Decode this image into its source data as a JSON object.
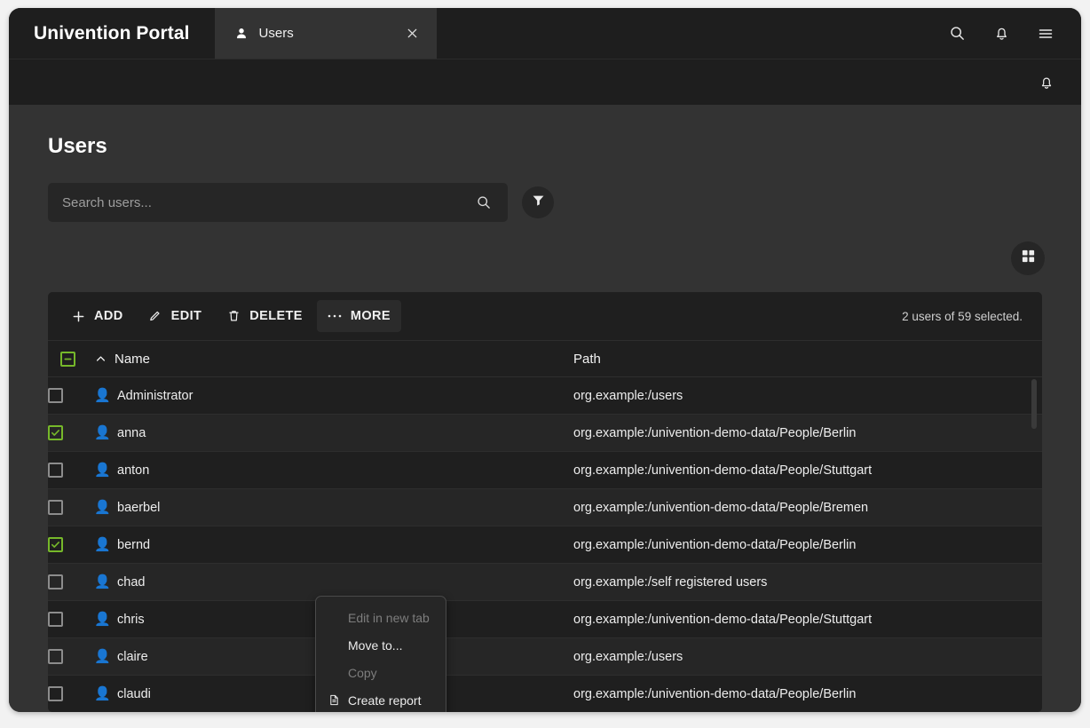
{
  "header": {
    "brand": "Univention Portal",
    "tab": {
      "label": "Users",
      "icon": "user-icon",
      "close_icon": "close-icon"
    },
    "actions": [
      {
        "name": "search-icon",
        "label": "Search"
      },
      {
        "name": "notifications-icon",
        "label": "Notifications"
      },
      {
        "name": "hamburger-menu-icon",
        "label": "Menu"
      }
    ]
  },
  "subbar": {
    "notification_icon": "bell-icon"
  },
  "main": {
    "title": "Users",
    "search": {
      "value": "",
      "placeholder": "Search users...",
      "submit_icon": "search-icon"
    },
    "filter_button": {
      "icon": "filter-icon"
    },
    "view_toggle": {
      "icon": "grid-view-icon"
    }
  },
  "toolbar": {
    "add_label": "ADD",
    "edit_label": "EDIT",
    "delete_label": "DELETE",
    "more_label": "MORE",
    "selection_info": "2 users of 59 selected."
  },
  "more_menu": {
    "items": [
      {
        "label": "Edit in new tab",
        "disabled": true,
        "icon": null
      },
      {
        "label": "Move to...",
        "disabled": false,
        "icon": null
      },
      {
        "label": "Copy",
        "disabled": true,
        "icon": null
      },
      {
        "label": "Create report",
        "disabled": false,
        "icon": "document-icon"
      }
    ]
  },
  "table": {
    "header_checkbox_state": "indeterminate",
    "columns": [
      {
        "key": "name",
        "label": "Name",
        "sorted": true,
        "sort_dir": "asc"
      },
      {
        "key": "path",
        "label": "Path",
        "sorted": false
      }
    ],
    "rows": [
      {
        "name": "Administrator",
        "path": "org.example:/users",
        "selected": false
      },
      {
        "name": "anna",
        "path": "org.example:/univention-demo-data/People/Berlin",
        "selected": true
      },
      {
        "name": "anton",
        "path": "org.example:/univention-demo-data/People/Stuttgart",
        "selected": false
      },
      {
        "name": "baerbel",
        "path": "org.example:/univention-demo-data/People/Bremen",
        "selected": false
      },
      {
        "name": "bernd",
        "path": "org.example:/univention-demo-data/People/Berlin",
        "selected": true
      },
      {
        "name": "chad",
        "path": "org.example:/self registered users",
        "selected": false
      },
      {
        "name": "chris",
        "path": "org.example:/univention-demo-data/People/Stuttgart",
        "selected": false
      },
      {
        "name": "claire",
        "path": "org.example:/users",
        "selected": false
      },
      {
        "name": "claudi",
        "path": "org.example:/univention-demo-data/People/Berlin",
        "selected": false
      }
    ]
  },
  "colors": {
    "accent_green": "#76b82a",
    "page_bg": "#333333",
    "header_bg": "#1e1e1e",
    "card_bg": "#1f1f1f"
  }
}
